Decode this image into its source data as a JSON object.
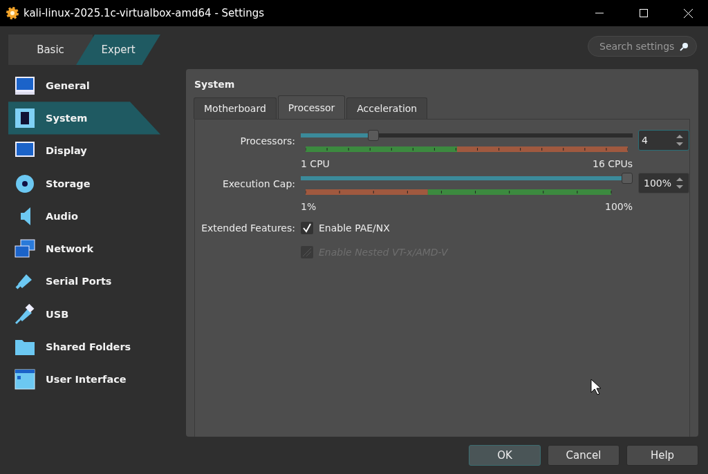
{
  "window": {
    "title": "kali-linux-2025.1c-virtualbox-amd64 - Settings"
  },
  "modes": [
    {
      "label": "Basic",
      "selected": false
    },
    {
      "label": "Expert",
      "selected": true
    }
  ],
  "search": {
    "placeholder": "Search settings"
  },
  "sidebar": {
    "items": [
      {
        "label": "General",
        "kind": "general",
        "selected": false
      },
      {
        "label": "System",
        "kind": "system",
        "selected": true
      },
      {
        "label": "Display",
        "kind": "display",
        "selected": false
      },
      {
        "label": "Storage",
        "kind": "storage",
        "selected": false
      },
      {
        "label": "Audio",
        "kind": "audio",
        "selected": false
      },
      {
        "label": "Network",
        "kind": "network",
        "selected": false
      },
      {
        "label": "Serial Ports",
        "kind": "serial",
        "selected": false
      },
      {
        "label": "USB",
        "kind": "usb",
        "selected": false
      },
      {
        "label": "Shared Folders",
        "kind": "folder",
        "selected": false
      },
      {
        "label": "User Interface",
        "kind": "ui",
        "selected": false
      }
    ]
  },
  "section_title": "System",
  "tabs": [
    {
      "label": "Motherboard",
      "selected": false
    },
    {
      "label": "Processor",
      "selected": true
    },
    {
      "label": "Acceleration",
      "selected": false
    }
  ],
  "sliders": [
    {
      "label": "Processors:",
      "kind": "cpu",
      "level": 0.21,
      "value": "4",
      "focused": true,
      "min_label": "1 CPU",
      "max_label": "16 CPUs"
    },
    {
      "label": "Execution Cap:",
      "kind": "cap",
      "level": 1,
      "value": "100%",
      "focused": false,
      "min_label": "1%",
      "max_label": "100%"
    }
  ],
  "features": {
    "label": "Extended Features:",
    "options": [
      {
        "label": "Enable PAE/NX",
        "checked": true,
        "disabled": false
      },
      {
        "label": "Enable Nested VT-x/AMD-V",
        "checked": false,
        "disabled": true
      }
    ]
  },
  "buttons": [
    {
      "label": "OK",
      "default": true
    },
    {
      "label": "Cancel",
      "default": false
    },
    {
      "label": "Help",
      "default": false
    }
  ]
}
